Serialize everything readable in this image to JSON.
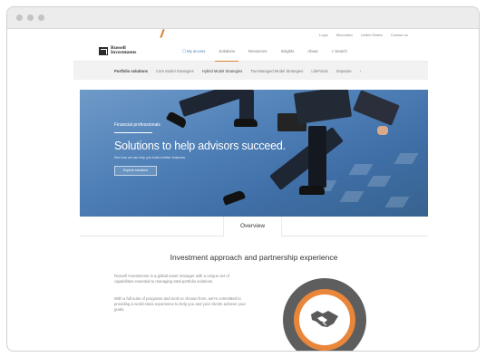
{
  "utility_nav": [
    "Login",
    "Microsites",
    "United States",
    "Contact us"
  ],
  "logo": {
    "line1": "Russell",
    "line2": "Investments"
  },
  "main_nav": {
    "access": "My access",
    "items": [
      "Solutions",
      "Resources",
      "Insights",
      "About"
    ],
    "search": "Search"
  },
  "sub_nav": {
    "title": "Portfolio solutions",
    "items": [
      "Core Model Strategies",
      "Hybrid Model Strategies",
      "Tax-Managed Model Strategies",
      "LifePoints",
      "Separate"
    ]
  },
  "hero": {
    "label": "Financial professionals",
    "title": "Solutions to help advisors succeed.",
    "subtitle": "See how we can help you build a better business.",
    "button": "Explore solutions"
  },
  "tabs": {
    "overview": "Overview"
  },
  "section": {
    "title": "Investment approach and partnership experience",
    "para1": "Russell Investments is a global asset manager with a unique set of capabilities essential to managing total portfolio solutions.",
    "para2": "With a full suite of programs and tools to choose from, we're committed to providing a world-class experience to help you and your clients achieve your goals."
  },
  "badge_icon": "handshake-icon",
  "colors": {
    "accent": "#d9822b",
    "hero": "#4f80b7",
    "badge_ring": "#5e5e5e",
    "badge_orange": "#e9863a"
  }
}
